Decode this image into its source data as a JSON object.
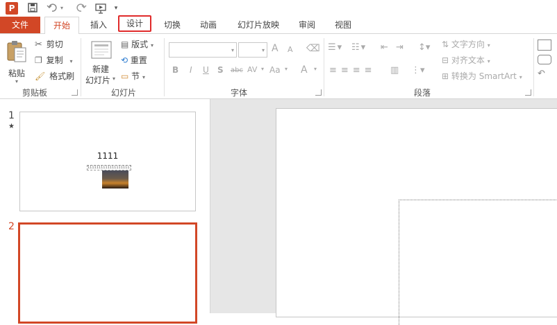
{
  "app": {
    "logo_letter": "P"
  },
  "qat": {
    "icons": [
      "powerpoint-logo",
      "save-icon",
      "undo-icon",
      "redo-icon",
      "start-from-beginning-icon",
      "customize-qat-icon"
    ]
  },
  "tabs": {
    "file": "文件",
    "items": [
      "开始",
      "插入",
      "设计",
      "切换",
      "动画",
      "幻灯片放映",
      "审阅",
      "视图"
    ]
  },
  "ribbon": {
    "clipboard": {
      "paste": "粘贴",
      "cut": "剪切",
      "copy": "复制",
      "format_painter": "格式刷",
      "group": "剪贴板"
    },
    "slides": {
      "new_slide_line1": "新建",
      "new_slide_line2": "幻灯片",
      "layout": "版式",
      "reset": "重置",
      "section": "节",
      "group": "幻灯片"
    },
    "font": {
      "font_name": "",
      "font_size": "",
      "grow": "A",
      "shrink": "A",
      "bold": "B",
      "italic": "I",
      "underline": "U",
      "shadow": "S",
      "strike": "abc",
      "spacing": "AV",
      "case": "Aa",
      "color": "A",
      "group": "字体"
    },
    "paragraph": {
      "text_direction": "文字方向",
      "align_text": "对齐文本",
      "smartart": "转换为 SmartArt",
      "group": "段落"
    }
  },
  "slides_pane": {
    "slides": [
      {
        "number": "1",
        "star": "★",
        "title": "1111",
        "subtitle": "111111111111111111111"
      },
      {
        "number": "2"
      }
    ]
  },
  "colors": {
    "accent": "#d24726",
    "highlight_border": "#e02a2a"
  }
}
